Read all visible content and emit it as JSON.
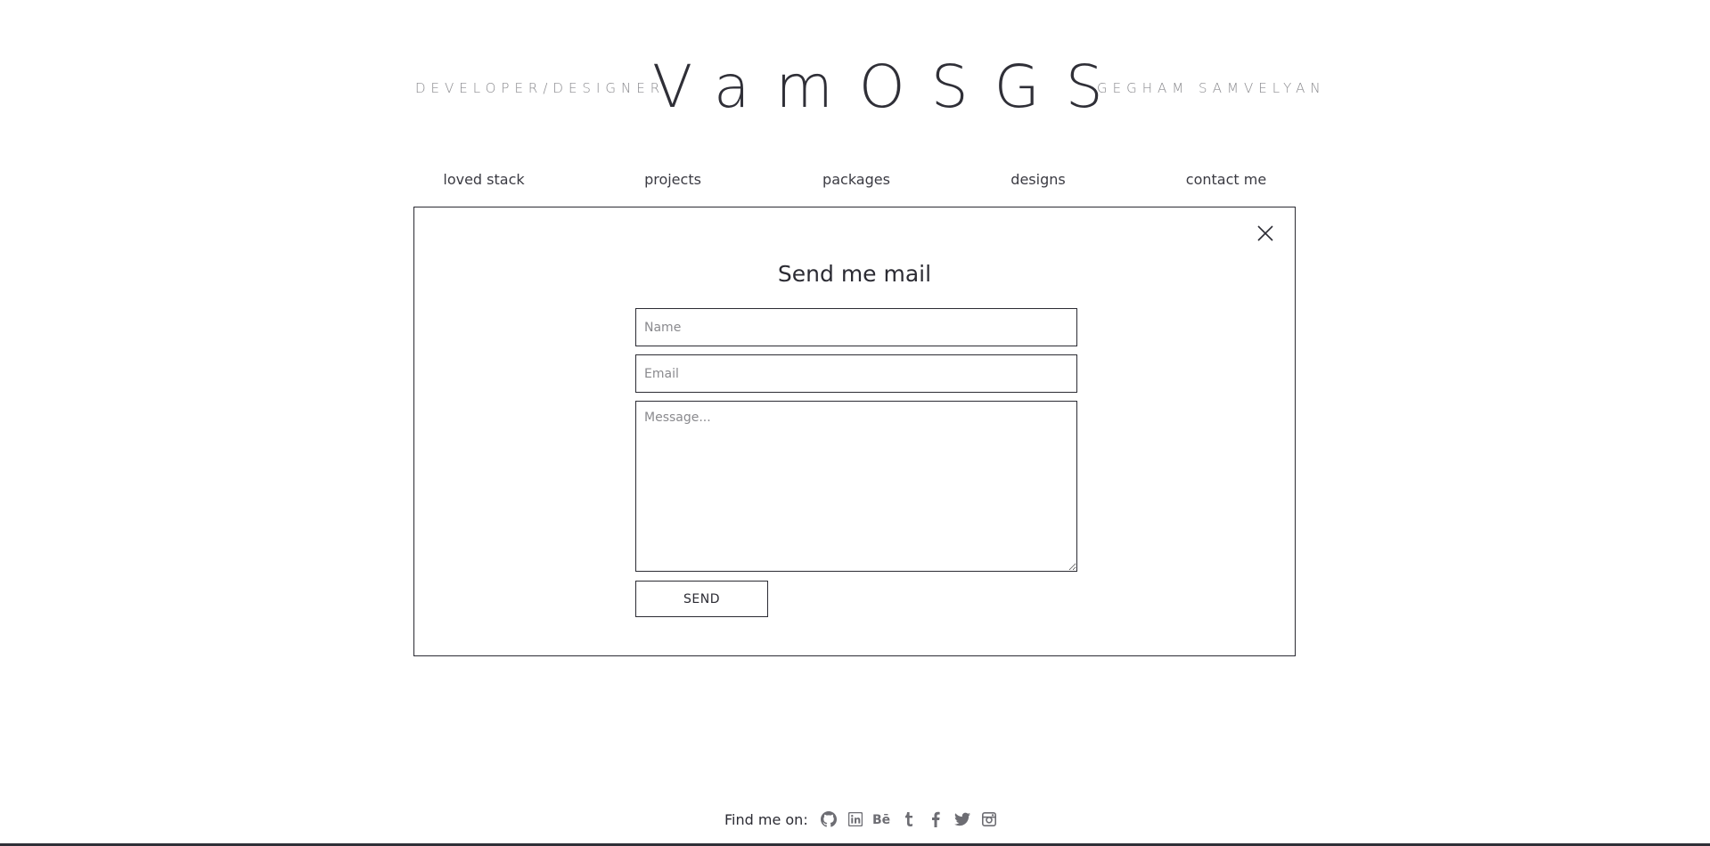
{
  "header": {
    "tagline_left": "DEVELOPER/DESIGNER",
    "logo": "VamOSGS",
    "tagline_right": "GEGHAM SAMVELYAN"
  },
  "nav": {
    "items": [
      {
        "label": "loved stack"
      },
      {
        "label": "projects"
      },
      {
        "label": "packages"
      },
      {
        "label": "designs"
      },
      {
        "label": "contact me"
      }
    ]
  },
  "contact_form": {
    "title": "Send me mail",
    "name_placeholder": "Name",
    "email_placeholder": "Email",
    "message_placeholder": "Message...",
    "send_label": "SEND",
    "close_icon": "close-icon"
  },
  "footer": {
    "find_label": "Find me on:",
    "social_icons": [
      "github-icon",
      "linkedin-icon",
      "behance-icon",
      "tumblr-icon",
      "facebook-icon",
      "twitter-icon",
      "instagram-icon"
    ],
    "icon_color": "#6d6d73"
  },
  "colors": {
    "text": "#2b2b33",
    "muted": "#8a8a8e",
    "background": "#ffffff"
  }
}
